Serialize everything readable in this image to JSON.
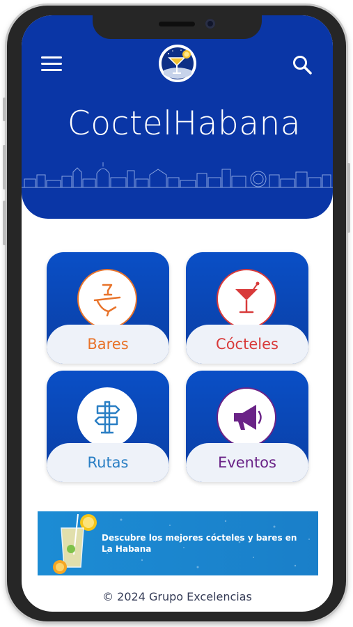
{
  "app": {
    "title": "CoctelHabana",
    "logo_icon": "cocktail-logo-icon",
    "menu_icon": "hamburger-menu-icon",
    "search_icon": "search-icon",
    "brand_color": "#0a36a6"
  },
  "tiles": [
    {
      "label": "Bares",
      "icon": "waiter-tray-icon",
      "color": "#e8732a"
    },
    {
      "label": "Cócteles",
      "icon": "cocktail-glass-icon",
      "color": "#d83a3a"
    },
    {
      "label": "Rutas",
      "icon": "signpost-icon",
      "color": "#2a7fc4"
    },
    {
      "label": "Eventos",
      "icon": "megaphone-icon",
      "color": "#6a2387"
    }
  ],
  "banner": {
    "text": "Descubre los mejores cócteles y bares en La Habana",
    "image_icon": "lemonade-glass-icon"
  },
  "footer": {
    "text": "© 2024 Grupo Excelencias"
  }
}
